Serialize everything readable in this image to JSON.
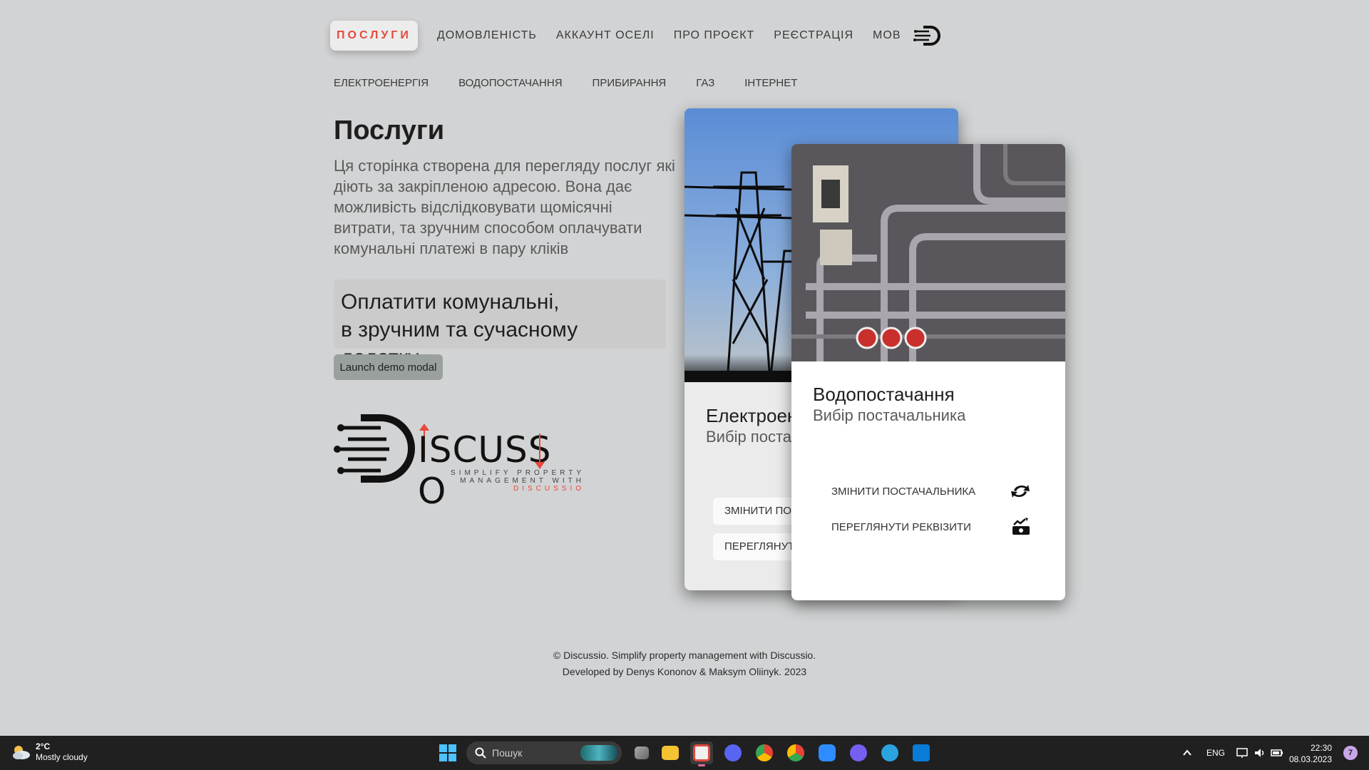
{
  "topnav": {
    "items": [
      "Послуги",
      "Домовленість",
      "Аккаунт оселі",
      "Про проєкт",
      "Реєстрація",
      "Мов"
    ],
    "active_index": 0
  },
  "subnav": {
    "items": [
      "Електроенергія",
      "Водопостачання",
      "Прибирання",
      "Газ",
      "Інтернет"
    ]
  },
  "main": {
    "title": "Послуги",
    "description": "Ця сторінка створена для перегляду послуг які діють за закріпленою адресою. Вона дає можливість відслідковувати щомісячні витрати, та зручним способом оплачувати комунальні платежі в пару кліків",
    "promo_line1": "Оплатити комунальні,",
    "promo_line2": "в зручним та сучасному додатку.",
    "demo_button": "Launch demo modal"
  },
  "brand": {
    "word": "ISCUSS O",
    "tag_line1": "SIMPLIFY PROPERTY",
    "tag_line2": "MANAGEMENT WITH",
    "tag_line3": "DISCUSSIO"
  },
  "cards": {
    "back": {
      "title": "Електроенергія",
      "subtitle": "Вибір постачальника",
      "action1": "Змінити постачальника",
      "action2": "Переглянути реквізити"
    },
    "front": {
      "title": "Водопостачання",
      "subtitle": "Вибір постачальника",
      "action1": "Змінити постачальника",
      "action2": "Переглянути реквізити"
    }
  },
  "footer": {
    "line1": "© Discussio. Simplify property management with Discussio.",
    "line2": "Developed by Denys Kononov & Maksym Oliinyk. 2023"
  },
  "taskbar": {
    "weather_temp": "2°C",
    "weather_desc": "Mostly cloudy",
    "search_placeholder": "Пошук",
    "lang": "ENG",
    "time": "22:30",
    "date": "08.03.2023",
    "notification_count": "7",
    "apps": [
      "file-explorer",
      "taskview",
      "folder",
      "snipping-tool",
      "discord",
      "chrome",
      "chrome-dev",
      "zoom",
      "viber",
      "telegram",
      "vscode"
    ]
  },
  "colors": {
    "background": "#d2d3d4",
    "accent_red": "#e64a3c",
    "taskbar": "#202020"
  }
}
